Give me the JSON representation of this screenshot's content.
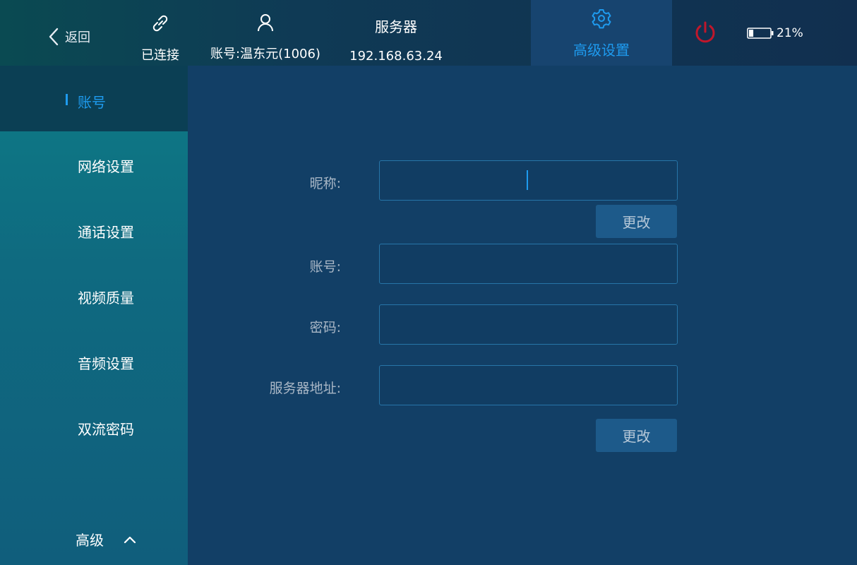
{
  "topbar": {
    "back_label": "返回",
    "connection_status": "已连接",
    "account_label": "账号:温东元(1006)",
    "server_title": "服务器",
    "server_ip": "192.168.63.24",
    "advanced_settings_label": "高级设置",
    "battery_level": "21%",
    "battery_fraction": 0.21,
    "icons": {
      "back": "chevron-left-icon",
      "connection": "link-icon",
      "account": "user-icon",
      "advanced": "gear-icon",
      "power": "power-icon",
      "battery": "battery-icon"
    },
    "accent_color": "#1e9bef",
    "power_color": "#c0172b"
  },
  "sidebar": {
    "active_item": "账号",
    "items": [
      {
        "label": "账号"
      },
      {
        "label": "网络设置"
      },
      {
        "label": "通话设置"
      },
      {
        "label": "视频质量"
      },
      {
        "label": "音频设置"
      },
      {
        "label": "双流密码"
      }
    ],
    "advanced_label": "高级"
  },
  "form": {
    "nickname_label": "昵称:",
    "nickname_value": "",
    "change_button_1": "更改",
    "account_label": "账号:",
    "account_value": "",
    "password_label": "密码:",
    "password_value": "",
    "server_address_label": "服务器地址:",
    "server_address_value": "",
    "change_button_2": "更改"
  }
}
